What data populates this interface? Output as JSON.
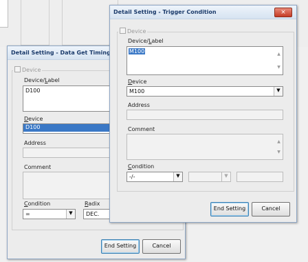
{
  "colors": {
    "title_text": "#1b3b6b",
    "selection": "#3a78c6",
    "close_button": "#c43b25"
  },
  "icons": {
    "close": "close-icon",
    "dropdown": "chevron-down-icon"
  },
  "data_get_dialog": {
    "title": "Detail Setting - Data Get Timing",
    "group_label": "Device",
    "device_label": "Device/Label",
    "device_label_value": "D100",
    "device_label_text": "Device",
    "device_selected": "D100",
    "address_label": "Address",
    "comment_label": "Comment",
    "condition_label": "Condition",
    "condition_value": "=",
    "radix_label": "Radix",
    "radix_value": "DEC.",
    "end_setting_label": "End Setting",
    "cancel_label": "Cancel"
  },
  "trigger_dialog": {
    "title": "Detail Setting - Trigger Condition",
    "close_symbol": "×",
    "group_label": "Device",
    "device_label": "Device/Label",
    "device_label_value": "M100",
    "device_label_text": "Device",
    "device_value": "M100",
    "address_label": "Address",
    "comment_label": "Comment",
    "condition_label": "Condition",
    "condition_value": "-/-",
    "end_setting_label": "End Setting",
    "cancel_label": "Cancel"
  }
}
